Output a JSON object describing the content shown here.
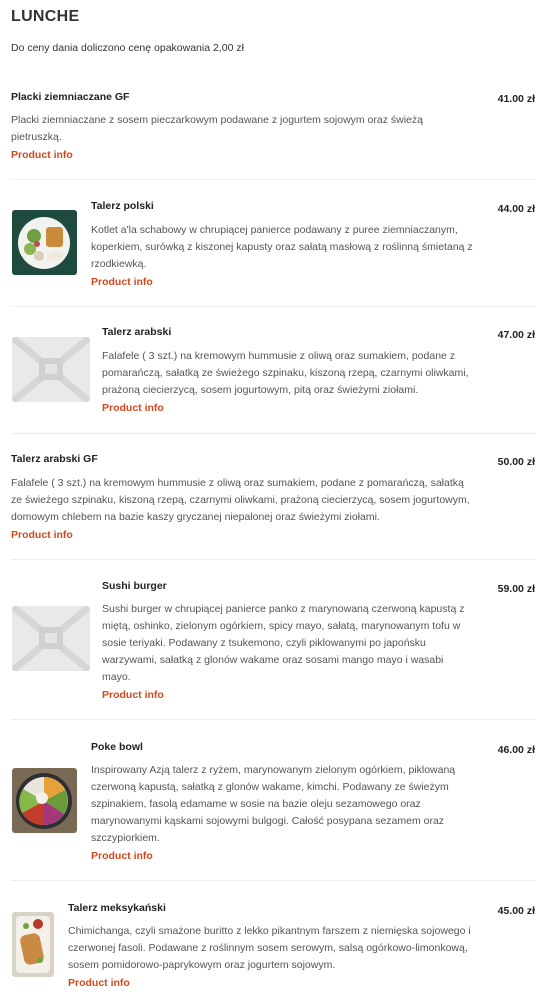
{
  "section": {
    "title": "LUNCHE",
    "note": "Do ceny dania doliczono cenę opakowania 2,00 zł"
  },
  "link_label": "Product info",
  "accent_color": "#d0491e",
  "items": [
    {
      "name": "Placki ziemniaczane GF",
      "price": "41.00 zł",
      "desc_lines": [
        "Placki ziemniaczane z sosem pieczarkowym podawane z jogurtem sojowym oraz świeżą",
        "pietruszką."
      ],
      "image": "none"
    },
    {
      "name": "Talerz polski",
      "price": "44.00 zł",
      "desc_lines": [
        "Kotlet a'la schabowy w chrupiącej panierce podawany z puree ziemniaczanym,",
        "koperkiem, surówką z kiszonej kapusty oraz sałatą masłową z roślinną śmietaną z",
        "rzodkiewką."
      ],
      "image": "photo-plate-schnitzel"
    },
    {
      "name": "Talerz arabski",
      "price": "47.00 zł",
      "desc_lines": [
        "Falafele ( 3 szt.) na kremowym hummusie z oliwą oraz sumakiem, podane z",
        "pomarańczą, sałatką ze świeżego szpinaku, kiszoną rzepą, czarnymi oliwkami,",
        "prażoną ciecierzycą, sosem jogurtowym, pitą oraz świeżymi ziołami."
      ],
      "image": "placeholder"
    },
    {
      "name": "Talerz arabski GF",
      "price": "50.00 zł",
      "desc_lines": [
        "Falafele ( 3 szt.) na kremowym hummusie z oliwą oraz sumakiem, podane z pomarańczą, sałatką",
        "ze świeżego szpinaku, kiszoną rzepą, czarnymi oliwkami, prażoną ciecierzycą, sosem jogurtowym,",
        "domowym chlebem na bazie kaszy gryczanej niepalonej oraz świeżymi ziołami."
      ],
      "image": "none"
    },
    {
      "name": "Sushi burger",
      "price": "59.00 zł",
      "desc_lines": [
        "Sushi burger w chrupiącej panierce panko z marynowaną czerwoną kapustą z",
        "miętą, oshinko, zielonym ogórkiem, spicy mayo, sałatą, marynowanym tofu w",
        "sosie teriyaki. Podawany z tsukemono, czyli piklowanymi po japońsku",
        "warzywami, sałatką z glonów wakame oraz sosami mango mayo i wasabi",
        "mayo."
      ],
      "image": "placeholder"
    },
    {
      "name": "Poke bowl",
      "price": "46.00 zł",
      "desc_lines": [
        "Inspirowany Azją talerz z ryżem, marynowanym zielonym ogórkiem, piklowaną",
        "czerwoną kapustą, sałatką z glonów wakame, kimchi. Podawany ze świeżym",
        "szpinakiem, fasolą edamame w sosie na bazie oleju sezamowego oraz",
        "marynowanymi kąskami sojowymi bulgogi. Całość posypana sezamem oraz",
        "szczypiorkiem."
      ],
      "image": "photo-poke-bowl"
    },
    {
      "name": "Talerz meksykański",
      "price": "45.00 zł",
      "desc_lines": [
        "Chimichanga, czyli smażone buritto z lekko pikantnym farszem z niemięska sojowego i",
        "czerwonej fasoli. Podawane z roślinnym sosem serowym, salsą ogórkowo-limonkową,",
        "sosem pomidorowo-paprykowym oraz jogurtem sojowym."
      ],
      "image": "photo-burrito-plate"
    }
  ]
}
